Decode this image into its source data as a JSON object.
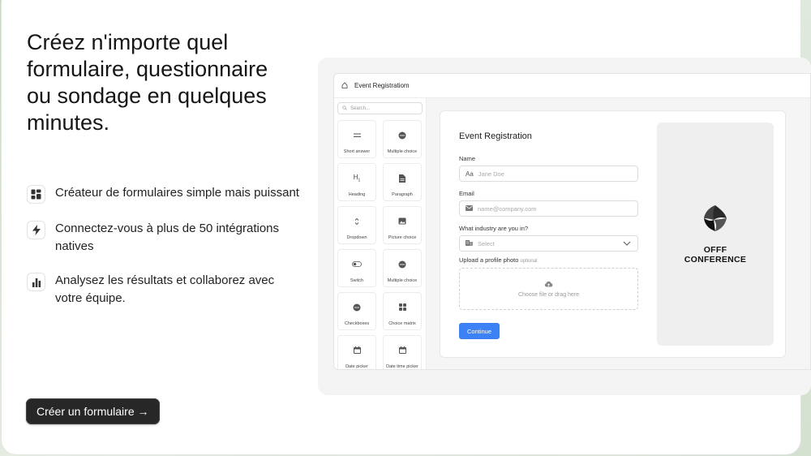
{
  "hero": {
    "headline": "Créez n'importe quel formulaire, questionnaire ou sondage en quelques minutes.",
    "features": [
      {
        "icon": "layout-icon",
        "text": "Créateur de formulaires simple mais puissant"
      },
      {
        "icon": "lightning-icon",
        "text": "Connectez-vous à plus de 50 intégrations natives"
      },
      {
        "icon": "bar-chart-icon",
        "text": "Analysez les résultats et collaborez avec votre équipe."
      }
    ],
    "cta_label": "Créer un formulaire →"
  },
  "app": {
    "header_title": "Event Registratiom",
    "search_placeholder": "Search...",
    "blocks": [
      {
        "icon": "short-answer-icon",
        "label": "Short answer"
      },
      {
        "icon": "multiple-choice-icon",
        "label": "Multiple choice"
      },
      {
        "icon": "heading-icon",
        "label": "Heading"
      },
      {
        "icon": "paragraph-icon",
        "label": "Paragraph"
      },
      {
        "icon": "dropdown-icon",
        "label": "Dropdown"
      },
      {
        "icon": "picture-choice-icon",
        "label": "Picture choice"
      },
      {
        "icon": "switch-icon",
        "label": "Switch"
      },
      {
        "icon": "multiple-choice-icon",
        "label": "Multiple choice"
      },
      {
        "icon": "checkboxes-icon",
        "label": "Checkboxes"
      },
      {
        "icon": "choice-matrix-icon",
        "label": "Choice matrix"
      },
      {
        "icon": "calendar-icon",
        "label": "Date picker"
      },
      {
        "icon": "calendar-icon",
        "label": "Date time picker"
      }
    ],
    "form": {
      "title": "Event Registration",
      "name_label": "Name",
      "name_placeholder": "Jane Doe",
      "name_prefix": "Aa",
      "email_label": "Email",
      "email_placeholder": "name@company.com",
      "industry_label": "What industry are you in?",
      "industry_placeholder": "Select",
      "upload_label": "Upload a profile photo",
      "upload_optional": "optional",
      "upload_hint": "Choose file or drag here",
      "continue_label": "Continue"
    },
    "side_panel": {
      "logo_line1": "OFFF",
      "logo_line2": "CONFERENCE"
    }
  },
  "colors": {
    "cta_background": "#272727",
    "continue_button": "#3c82f6",
    "headline_text": "#161616"
  }
}
